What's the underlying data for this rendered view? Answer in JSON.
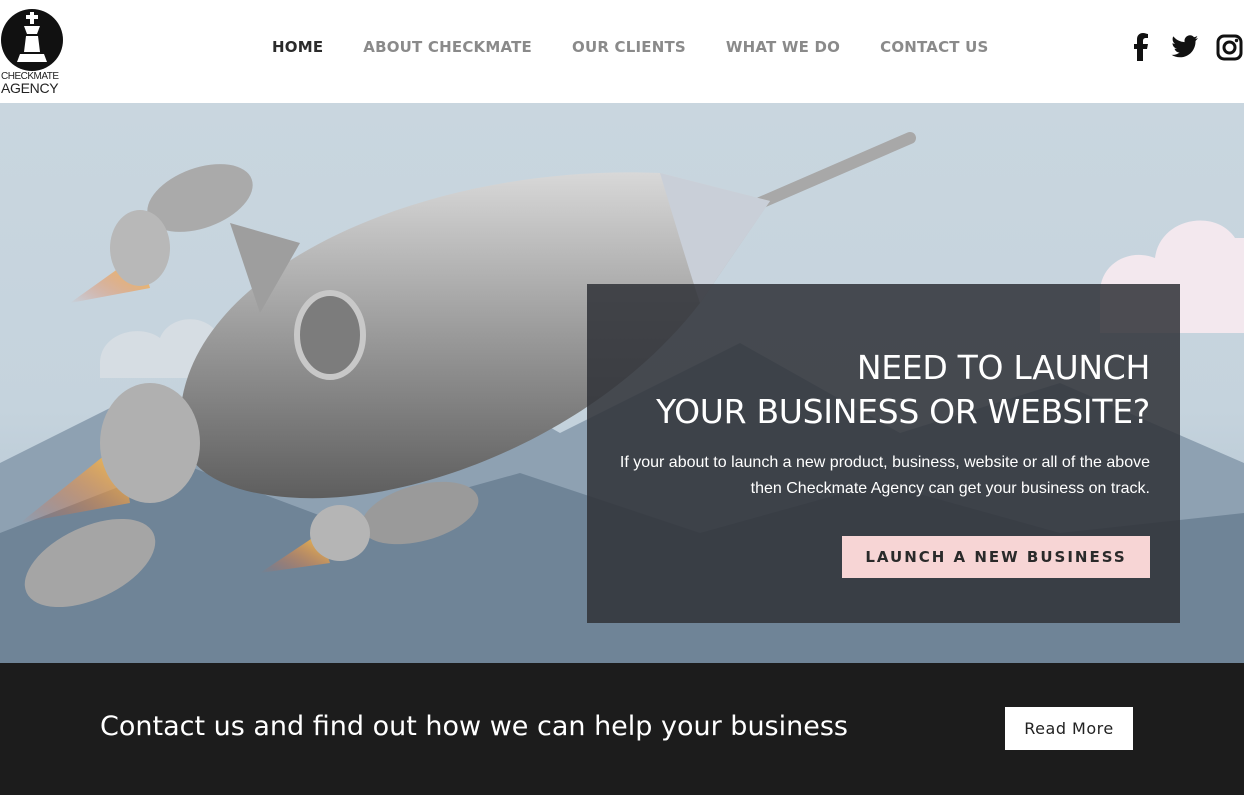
{
  "logo": {
    "line1": "CHECKMATE",
    "line2": "AGENCY"
  },
  "nav": {
    "items": [
      {
        "label": "HOME",
        "active": true
      },
      {
        "label": "ABOUT CHECKMATE",
        "active": false
      },
      {
        "label": "OUR CLIENTS",
        "active": false
      },
      {
        "label": "WHAT WE DO",
        "active": false
      },
      {
        "label": "CONTACT US",
        "active": false
      }
    ]
  },
  "social": {
    "icons": [
      "facebook-icon",
      "twitter-icon",
      "instagram-icon"
    ]
  },
  "hero": {
    "title_line1": "NEED TO LAUNCH",
    "title_line2": "YOUR BUSINESS OR WEBSITE?",
    "text": "If your about to launch a new product, business, website or all of the above then Checkmate Agency can get your business on track.",
    "cta_label": "LAUNCH A NEW BUSINESS"
  },
  "band": {
    "message": "Contact us and find out how we can help your business",
    "button_label": "Read More"
  },
  "colors": {
    "cta_bg": "#f7d5d5",
    "band_bg": "#1c1c1c",
    "panel_bg": "#303238"
  }
}
